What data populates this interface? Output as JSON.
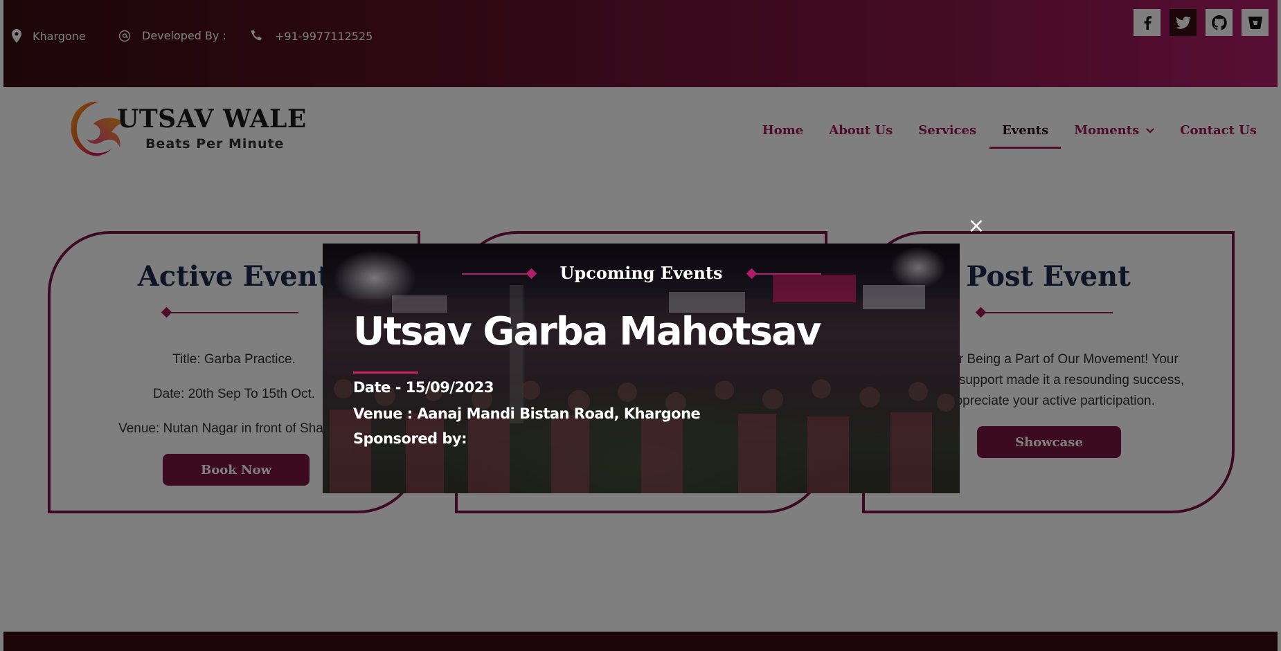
{
  "topbar": {
    "location": "Khargone",
    "developer_label": "Developed By :",
    "phone": "+91-9977112525",
    "socials": [
      "facebook-icon",
      "twitter-icon",
      "github-icon",
      "bitbucket-icon"
    ]
  },
  "brand": {
    "title": "UTSAV WALE",
    "tagline": "Beats Per Minute"
  },
  "nav": {
    "items": [
      {
        "label": "Home"
      },
      {
        "label": "About Us"
      },
      {
        "label": "Services"
      },
      {
        "label": "Events"
      },
      {
        "label": "Moments"
      },
      {
        "label": "Contact Us"
      }
    ],
    "active": "Events"
  },
  "cards": {
    "active": {
      "title": "Active Event",
      "line1": "Title: Garba Practice.",
      "line2": "Date: 20th Sep To 15th Oct.",
      "line3": "Venue: Nutan Nagar in front of Shakti D",
      "button": "Book Now"
    },
    "post": {
      "title": "Post Event",
      "line1": "for Being a Part of Our Movement! Your",
      "line2": "d support made it a resounding success,",
      "line3": "appreciate your active participation.",
      "button": "Showcase"
    }
  },
  "modal": {
    "heading": "Upcoming Events",
    "title": "Utsav Garba Mahotsav",
    "date": "Date - 15/09/2023",
    "venue": "Venue : Aanaj Mandi Bistan Road, Khargone",
    "sponsored": "Sponsored by:",
    "close": "×"
  },
  "colors": {
    "brand": "#7a1640",
    "accent": "#a0174f",
    "dark": "#3a0d12"
  }
}
